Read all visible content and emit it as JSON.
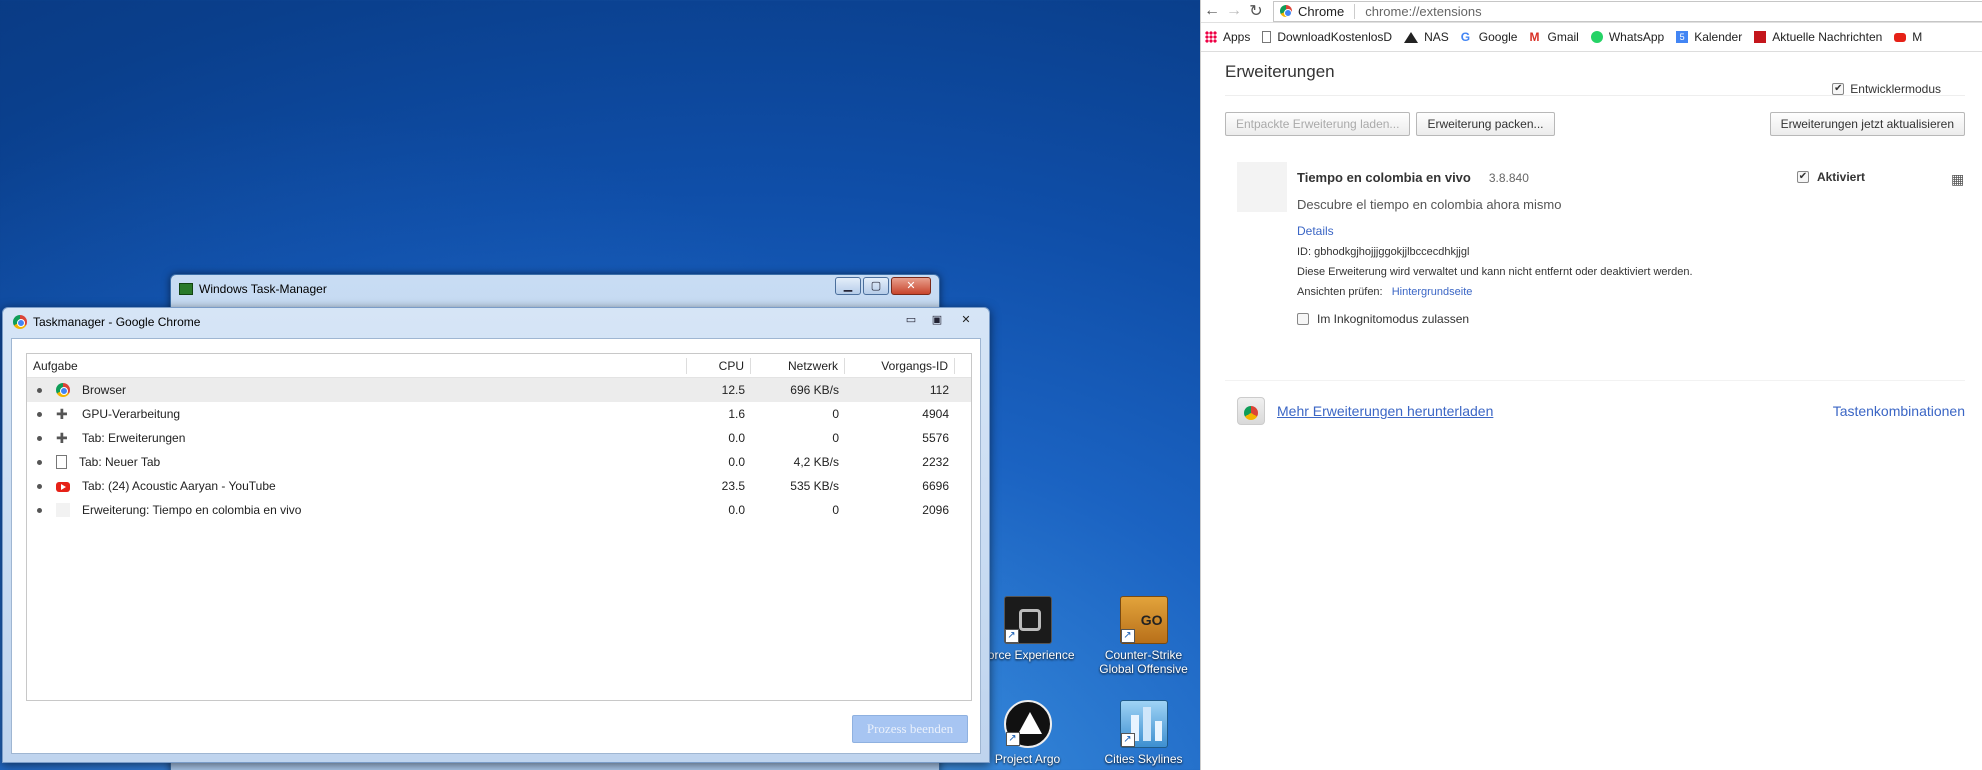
{
  "desktop": {
    "icons": [
      {
        "label": "Force Experience"
      },
      {
        "label": "Counter-Strike Global Offensive"
      },
      {
        "label": "Project Argo"
      },
      {
        "label": "Cities Skylines"
      }
    ]
  },
  "win_taskmanager": {
    "title": "Windows Task-Manager"
  },
  "chrome_taskmanager": {
    "title": "Taskmanager - Google Chrome",
    "columns": {
      "task": "Aufgabe",
      "cpu": "CPU",
      "network": "Netzwerk",
      "pid": "Vorgangs-ID"
    },
    "rows": [
      {
        "icon": "chrome-icon",
        "task": "Browser",
        "cpu": "12.5",
        "network": "696 KB/s",
        "pid": "112"
      },
      {
        "icon": "puzzle-icon",
        "task": "GPU-Verarbeitung",
        "cpu": "1.6",
        "network": "0",
        "pid": "4904"
      },
      {
        "icon": "puzzle-icon",
        "task": "Tab: Erweiterungen",
        "cpu": "0.0",
        "network": "0",
        "pid": "5576"
      },
      {
        "icon": "page-icon",
        "task": "Tab: Neuer Tab",
        "cpu": "0.0",
        "network": "4,2 KB/s",
        "pid": "2232"
      },
      {
        "icon": "youtube-icon",
        "task": "Tab: (24) Acoustic Aaryan - YouTube",
        "cpu": "23.5",
        "network": "535 KB/s",
        "pid": "6696"
      },
      {
        "icon": "blank-icon",
        "task": "Erweiterung: Tiempo en colombia en vivo",
        "cpu": "0.0",
        "network": "0",
        "pid": "2096"
      }
    ],
    "end_button": "Prozess beenden"
  },
  "chrome": {
    "brand": "Chrome",
    "url": "chrome://extensions",
    "bookmarks": [
      "Apps",
      "DownloadKostenlosD",
      "NAS",
      "Google",
      "Gmail",
      "WhatsApp",
      "Kalender",
      "Aktuelle Nachrichten",
      "M"
    ],
    "page_title": "Erweiterungen",
    "dev_mode": "Entwicklermodus",
    "buttons": {
      "load_unpacked": "Entpackte Erweiterung laden...",
      "pack": "Erweiterung packen...",
      "update": "Erweiterungen jetzt aktualisieren"
    },
    "extension": {
      "name": "Tiempo en colombia en vivo",
      "version": "3.8.840",
      "description": "Descubre el tiempo en colombia ahora mismo",
      "details": "Details",
      "id_line": "ID: gbhodkgjhojjjggokjjlbccecdhkjjgl",
      "managed": "Diese Erweiterung wird verwaltet und kann nicht entfernt oder deaktiviert werden.",
      "views_label": "Ansichten prüfen:",
      "views_link": "Hintergrundseite",
      "enabled": "Aktiviert",
      "incognito": "Im Inkognitomodus zulassen"
    },
    "more_link": "Mehr Erweiterungen herunterladen",
    "shortcuts": "Tastenkombinationen"
  }
}
